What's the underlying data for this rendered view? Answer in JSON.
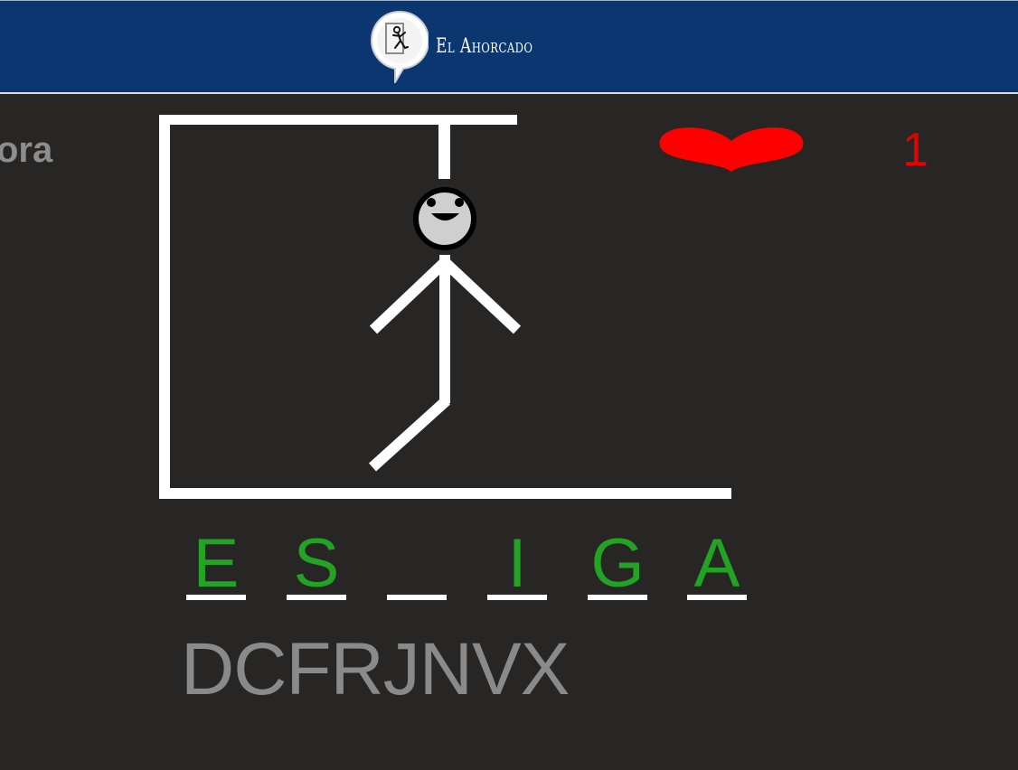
{
  "header": {
    "title": "El Ahorcado",
    "logo_icon": "hangman-speech-bubble-icon",
    "background": "#0c3670"
  },
  "side_label": "ora",
  "lives": {
    "icon": "heart-icon",
    "count": "1",
    "color": "#e60000"
  },
  "word": {
    "slots": [
      "E",
      "S",
      "",
      "I",
      "G",
      "A"
    ],
    "revealed_color": "#22a323",
    "underline_color": "#ffffff"
  },
  "missed_letters": "DCFRJNVX",
  "colors": {
    "background": "#272625",
    "missed_text": "#8a8a8a",
    "drawing": "#ffffff"
  }
}
